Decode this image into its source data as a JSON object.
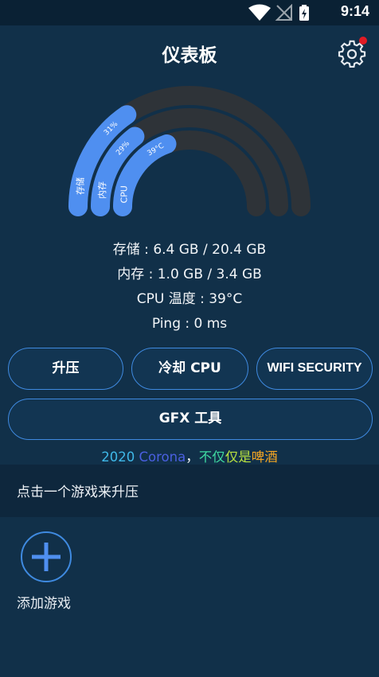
{
  "status_bar": {
    "time": "9:14",
    "icons": [
      "wifi-icon",
      "signal-off-icon",
      "battery-charging-icon"
    ]
  },
  "header": {
    "title": "仪表板",
    "settings_icon": "gear-icon",
    "notification_color": "#e01b24"
  },
  "gauge": {
    "arcs": [
      {
        "label": "存储",
        "percent": "31%",
        "fraction": 0.31
      },
      {
        "label": "内存",
        "percent": "29%",
        "fraction": 0.29
      },
      {
        "label": "CPU",
        "percent": "39°C",
        "fraction": 0.39
      }
    ],
    "accent": "#4f8ff0",
    "track": "#2e3338"
  },
  "stats": [
    "存储 : 6.4 GB / 20.4 GB",
    "内存 : 1.0 GB / 3.4 GB",
    "CPU 温度 : 39°C",
    "Ping : 0 ms"
  ],
  "buttons": {
    "boost": "升压",
    "cool_cpu": "冷却 CPU",
    "wifi_security": "WIFI SECURITY",
    "gfx_tool": "GFX 工具"
  },
  "slogan": {
    "year": "2020",
    "corona": "Corona",
    "comma": "，",
    "p1": "不仅",
    "p2": "仅是",
    "p3": "啤酒"
  },
  "section": {
    "text": "点击一个游戏来升压"
  },
  "games": {
    "add_label": "添加游戏",
    "add_icon": "plus-icon"
  }
}
